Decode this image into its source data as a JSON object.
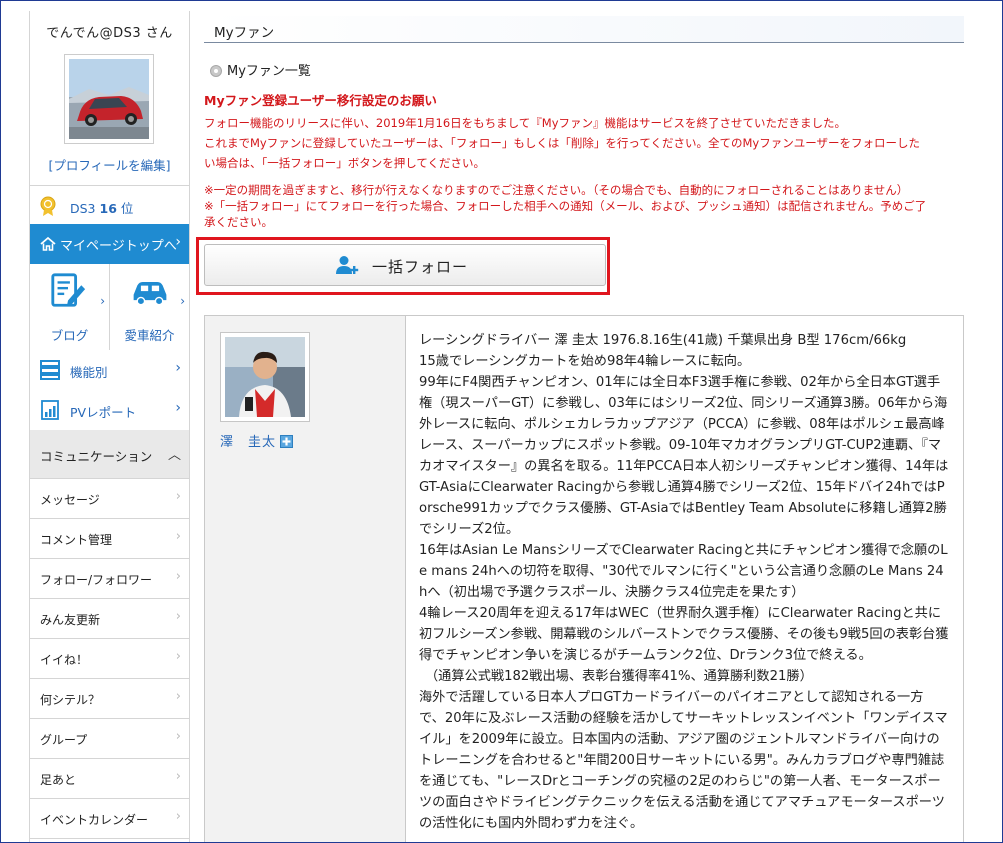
{
  "sidebar": {
    "user_name": "でんでん@DS3 さん",
    "edit_profile": "[プロフィールを編集]",
    "rank": {
      "prefix": "DS3",
      "number": "16",
      "suffix": "位"
    },
    "mypage_top": "マイページトップへ",
    "blog": "ブログ",
    "car_intro": "愛車紹介",
    "by_function": "機能別",
    "pv_report": "PVレポート",
    "communication": "コミュニケーション",
    "communication_items": [
      "メッセージ",
      "コメント管理",
      "フォロー/フォロワー",
      "みん友更新",
      "イイね！",
      "何シテル？",
      "グループ",
      "足あと",
      "イベントカレンダー"
    ]
  },
  "main": {
    "title": "Myファン",
    "list_link": "Myファン一覧",
    "notice_title": "Myファン登録ユーザー移行設定のお願い",
    "notice_lines": [
      "フォロー機能のリリースに伴い、2019年1月16日をもちまして『Myファン』機能はサービスを終了させていただきました。",
      "これまでMyファンに登録していたユーザーは、「フォロー」もしくは「削除」を行ってください。全てのMyファンユーザーをフォローした",
      "い場合は、「一括フォロー」ボタンを押してください。"
    ],
    "caution_lines": [
      "※一定の期間を過ぎますと、移行が行えなくなりますのでご注意ください。（その場合でも、自動的にフォローされることはありません）",
      "※「一括フォロー」にてフォローを行った場合、フォローした相手への通知（メール、および、プッシュ通知）は配信されません。予めご了",
      "承ください。"
    ],
    "bulk_follow": "一括フォロー",
    "driver_name": "澤　圭太",
    "bio_lines": [
      "レーシングドライバー 澤 圭太 1976.8.16生(41歳) 千葉県出身 B型 176cm/66kg",
      "15歳でレーシングカートを始め98年4輪レースに転向。",
      "99年にF4関西チャンピオン、01年には全日本F3選手権に参戦、02年から全日本GT選手権（現スーパーGT）に参戦し、03年にはシリーズ2位、同シリーズ通算3勝。06年から海外レースに転向、ポルシェカレラカップアジア（PCCA）に参戦、08年はポルシェ最高峰レース、スーパーカップにスポット参戦。09-10年マカオグランプリGT-CUP2連覇、『マカオマイスター』の異名を取る。11年PCCA日本人初シリーズチャンピオン獲得、14年はGT-AsiaにClearwater Racingから参戦し通算4勝でシリーズ2位、15年ドバイ24hではPorsche991カップでクラス優勝、GT-AsiaではBentley Team Absoluteに移籍し通算2勝でシリーズ2位。",
      "16年はAsian Le MansシリーズでClearwater Racingと共にチャンピオン獲得で念願のLe mans 24hへの切符を取得、\"30代でルマンに行く\"という公言通り念願のLe Mans 24hへ（初出場で予選クラスポール、決勝クラス4位完走を果たす）",
      "4輪レース20周年を迎える17年はWEC（世界耐久選手権）にClearwater Racingと共に初フルシーズン参戦、開幕戦のシルバーストンでクラス優勝、その後も9戦5回の表彰台獲得でチャンピオン争いを演じるがチームランク2位、Drランク3位で終える。",
      "（通算公式戦182戦出場、表彰台獲得率41%、通算勝利数21勝）",
      "海外で活躍している日本人プロGTカードライバーのパイオニアとして認知される一方で、20年に及ぶレース活動の経験を活かしてサーキットレッスンイベント「ワンデイスマイル」を2009年に設立。日本国内の活動、アジア圏のジェントルマンドライバー向けのトレーニングを合わせると\"年間200日サーキットにいる男\"。みんカラブログや専門雑誌を通じても、\"レースDrとコーチングの究極の2足のわらじ\"の第一人者、モータースポーツの面白さやドライビングテクニックを伝える活動を通じてアマチュアモータースポーツの活性化にも国内外問わず力を注ぐ。"
    ]
  },
  "colors": {
    "accent_blue": "#1f8bd1",
    "link_blue": "#2768b8",
    "notice_red": "#d3171b",
    "highlight_red": "#e0161e"
  }
}
